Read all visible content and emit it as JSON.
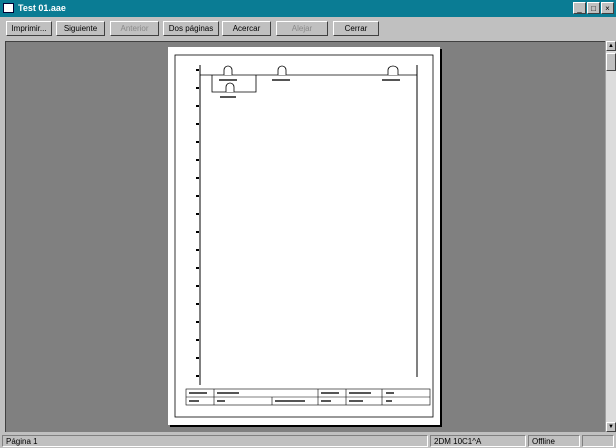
{
  "window": {
    "title": "Test 01.aae"
  },
  "toolbar": {
    "buttons": [
      {
        "label": "Imprimir...",
        "enabled": true
      },
      {
        "label": "Siguiente",
        "enabled": true
      },
      {
        "label": "Anterior",
        "enabled": false
      },
      {
        "label": "Dos páginas",
        "enabled": true
      },
      {
        "label": "Acercar",
        "enabled": true
      },
      {
        "label": "Alejar",
        "enabled": false
      },
      {
        "label": "Cerrar",
        "enabled": true
      }
    ]
  },
  "statusbar": {
    "page": "Página 1",
    "cursor": "2DM 10C1^A",
    "mode": "Offline"
  },
  "icons": {
    "window_icon": "app-icon",
    "minimize": "minimize-icon",
    "maximize": "maximize-icon",
    "close": "close-icon"
  }
}
